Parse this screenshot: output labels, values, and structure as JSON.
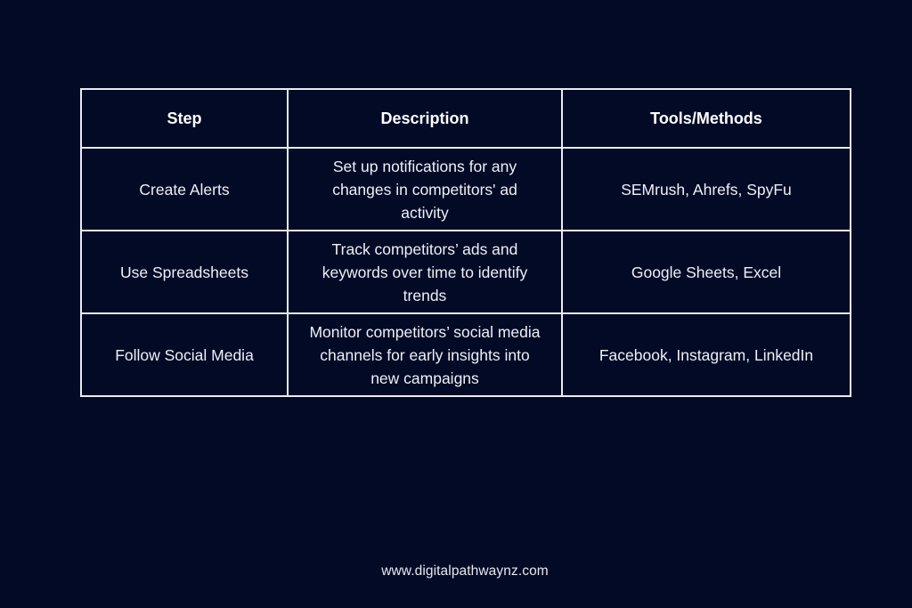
{
  "table": {
    "headers": [
      "Step",
      "Description",
      "Tools/Methods"
    ],
    "rows": [
      {
        "step": "Create Alerts",
        "description": "Set up notifications for any changes in competitors' ad activity",
        "tools": "SEMrush, Ahrefs, SpyFu"
      },
      {
        "step": "Use Spreadsheets",
        "description": "Track competitors’ ads and keywords over time to identify trends",
        "tools": "Google Sheets, Excel"
      },
      {
        "step": "Follow Social Media",
        "description": "Monitor competitors’ social media channels for early insights into new campaigns",
        "tools": "Facebook, Instagram, LinkedIn"
      }
    ]
  },
  "footer": {
    "website": "www.digitalpathwaynz.com"
  },
  "colors": {
    "background": "#020a26",
    "border": "#e9ecf3",
    "text": "#eef0f6"
  }
}
